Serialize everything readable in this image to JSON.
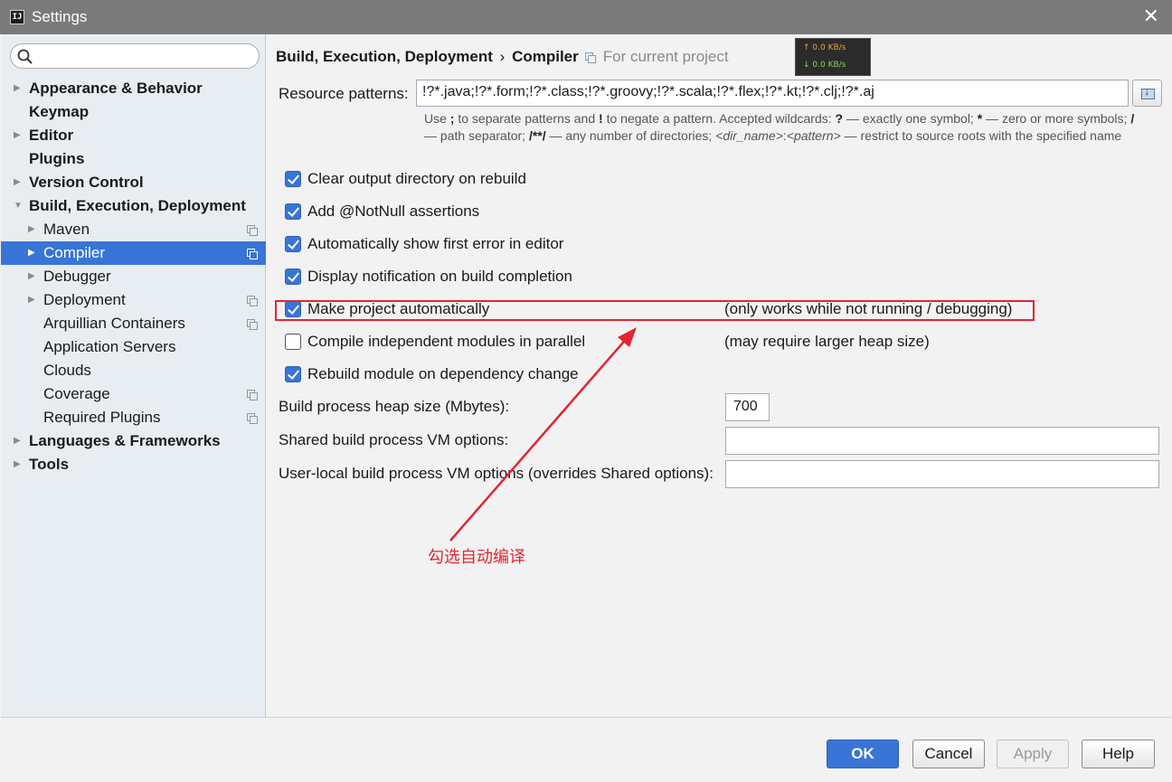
{
  "window": {
    "title": "Settings",
    "close_glyph": "✕",
    "icon_text": "IJ"
  },
  "search": {
    "placeholder": "",
    "value": ""
  },
  "tree": [
    {
      "label": "Appearance & Behavior",
      "level": 0,
      "arrow": "right",
      "bold": true,
      "copy": false
    },
    {
      "label": "Keymap",
      "level": 0,
      "arrow": "none",
      "bold": true,
      "copy": false
    },
    {
      "label": "Editor",
      "level": 0,
      "arrow": "right",
      "bold": true,
      "copy": false
    },
    {
      "label": "Plugins",
      "level": 0,
      "arrow": "none",
      "bold": true,
      "copy": false
    },
    {
      "label": "Version Control",
      "level": 0,
      "arrow": "right",
      "bold": true,
      "copy": false
    },
    {
      "label": "Build, Execution, Deployment",
      "level": 0,
      "arrow": "down",
      "bold": true,
      "copy": false
    },
    {
      "label": "Maven",
      "level": 1,
      "arrow": "right",
      "bold": false,
      "copy": true
    },
    {
      "label": "Compiler",
      "level": 1,
      "arrow": "right",
      "bold": false,
      "copy": true,
      "selected": true
    },
    {
      "label": "Debugger",
      "level": 1,
      "arrow": "right",
      "bold": false,
      "copy": false
    },
    {
      "label": "Deployment",
      "level": 1,
      "arrow": "right",
      "bold": false,
      "copy": true
    },
    {
      "label": "Arquillian Containers",
      "level": 1,
      "arrow": "none",
      "bold": false,
      "copy": true
    },
    {
      "label": "Application Servers",
      "level": 1,
      "arrow": "none",
      "bold": false,
      "copy": false
    },
    {
      "label": "Clouds",
      "level": 1,
      "arrow": "none",
      "bold": false,
      "copy": false
    },
    {
      "label": "Coverage",
      "level": 1,
      "arrow": "none",
      "bold": false,
      "copy": true
    },
    {
      "label": "Required Plugins",
      "level": 1,
      "arrow": "none",
      "bold": false,
      "copy": true
    },
    {
      "label": "Languages & Frameworks",
      "level": 0,
      "arrow": "right",
      "bold": true,
      "copy": false
    },
    {
      "label": "Tools",
      "level": 0,
      "arrow": "right",
      "bold": true,
      "copy": false
    }
  ],
  "header": {
    "crumb_parent": "Build, Execution, Deployment",
    "crumb_sep": "›",
    "crumb_current": "Compiler",
    "scope": "For current project"
  },
  "netmon": {
    "up": "↑ 0.0 KB/s",
    "down": "↓ 0.0 KB/s"
  },
  "resource": {
    "label": "Resource patterns:",
    "value": "!?*.java;!?*.form;!?*.class;!?*.groovy;!?*.scala;!?*.flex;!?*.kt;!?*.clj;!?*.aj"
  },
  "hint": {
    "p1": "Use ",
    "b1": ";",
    "p2": " to separate patterns and ",
    "b2": "!",
    "p3": " to negate a pattern. Accepted wildcards: ",
    "b3": "?",
    "p4": " — exactly one symbol; ",
    "b4": "*",
    "p5": " — zero or more symbols; ",
    "b5": "/",
    "p6": " — path separator; ",
    "b6": "/**/",
    "p7": " — any number of directories; ",
    "i1": "<dir_name>",
    "p8": ":",
    "i2": "<pattern>",
    "p9": " — restrict to source roots with the specified name"
  },
  "options": [
    {
      "label": "Clear output directory on rebuild",
      "checked": true,
      "note": ""
    },
    {
      "label": "Add @NotNull assertions",
      "checked": true,
      "note": ""
    },
    {
      "label": "Automatically show first error in editor",
      "checked": true,
      "note": ""
    },
    {
      "label": "Display notification on build completion",
      "checked": true,
      "note": ""
    },
    {
      "label": "Make project automatically",
      "checked": true,
      "note": "(only works while not running / debugging)"
    },
    {
      "label": "Compile independent modules in parallel",
      "checked": false,
      "note": "(may require larger heap size)"
    },
    {
      "label": "Rebuild module on dependency change",
      "checked": true,
      "note": ""
    }
  ],
  "fields": {
    "heap_label": "Build process heap size (Mbytes):",
    "heap_value": "700",
    "shared_label": "Shared build process VM options:",
    "shared_value": "",
    "local_label": "User-local build process VM options (overrides Shared options):",
    "local_value": ""
  },
  "annotation": {
    "text": "勾选自动编译",
    "color": "#e32530"
  },
  "buttons": {
    "ok": "OK",
    "cancel": "Cancel",
    "apply": "Apply",
    "help": "Help"
  },
  "colors": {
    "accent": "#3875d7",
    "highlight": "#e32530"
  }
}
